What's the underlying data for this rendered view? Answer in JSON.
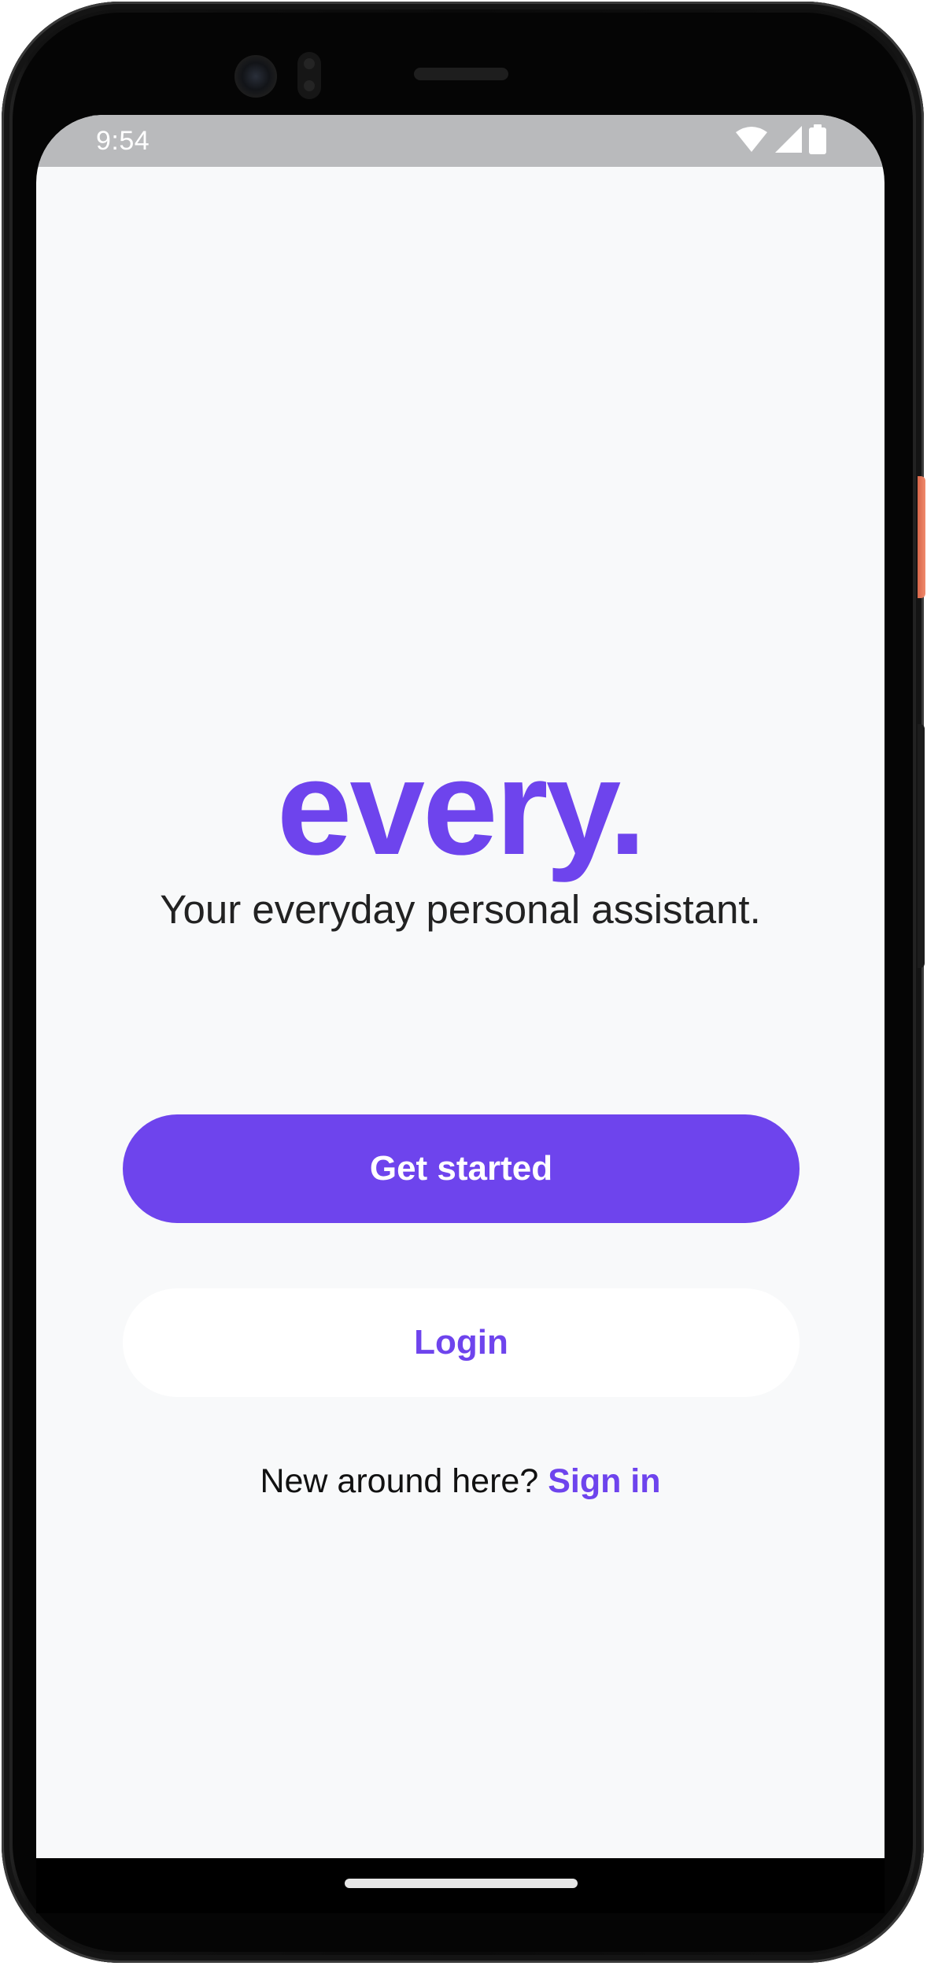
{
  "status_bar": {
    "time": "9:54",
    "icons": [
      "wifi-icon",
      "cellular-signal-icon",
      "battery-icon"
    ]
  },
  "brand": {
    "logo_text": "every.",
    "tagline": "Your everyday personal assistant."
  },
  "actions": {
    "primary_label": "Get started",
    "secondary_label": "Login"
  },
  "signup": {
    "prompt": "New around here?",
    "link_label": "Sign in"
  },
  "colors": {
    "accent": "#6e44ed",
    "background": "#f8f9fa",
    "status_bar": "#b9babc",
    "text": "#222222"
  }
}
